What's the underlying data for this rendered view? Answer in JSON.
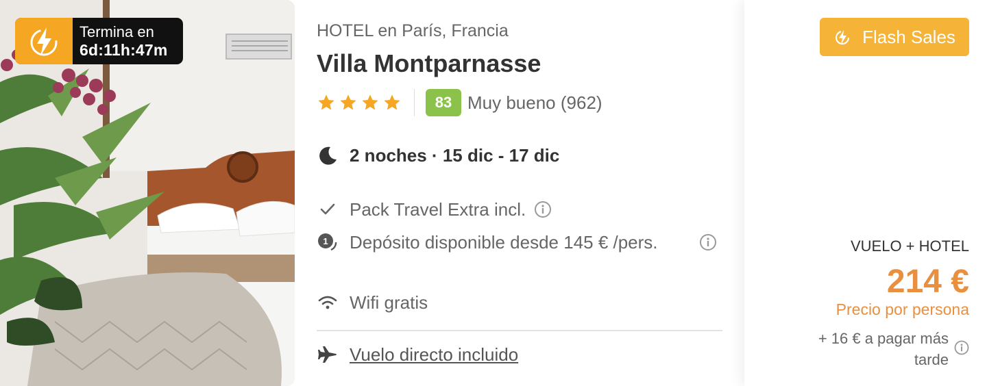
{
  "photo": {
    "alt_icon": "hotel-room-photo",
    "timer": {
      "label": "Termina en",
      "time": "6d:11h:47m",
      "icon": "lightning-bolt-icon",
      "colors": {
        "badge": "#f5a623",
        "bg": "#111111"
      }
    }
  },
  "hotel": {
    "category": "HOTEL en París, Francia",
    "name": "Villa Montparnasse",
    "stars": 4,
    "score": "83",
    "review_text": "Muy bueno (962)",
    "score_color": "#8bc34a"
  },
  "stay": {
    "icon": "moon-icon",
    "text": "2 noches · 15 dic - 17 dic"
  },
  "features": [
    {
      "icon": "check-icon",
      "text": "Pack Travel Extra incl.",
      "has_info": true
    },
    {
      "icon": "deposit-icon",
      "text": "Depósito disponible desde 145 € /pers.",
      "has_info": true
    },
    {
      "icon": "wifi-icon",
      "text": "Wifi gratis",
      "has_info": false
    }
  ],
  "flight": {
    "icon": "airplane-icon",
    "link_text": "Vuelo directo incluido"
  },
  "price": {
    "badge_label": "Flash Sales",
    "badge_icon": "flash-sale-icon",
    "badge_color": "#f5b337",
    "type": "VUELO + HOTEL",
    "amount": "214 €",
    "per": "Precio por persona",
    "extra": "+ 16 € a pagar más tarde",
    "accent_color": "#e8903f"
  }
}
